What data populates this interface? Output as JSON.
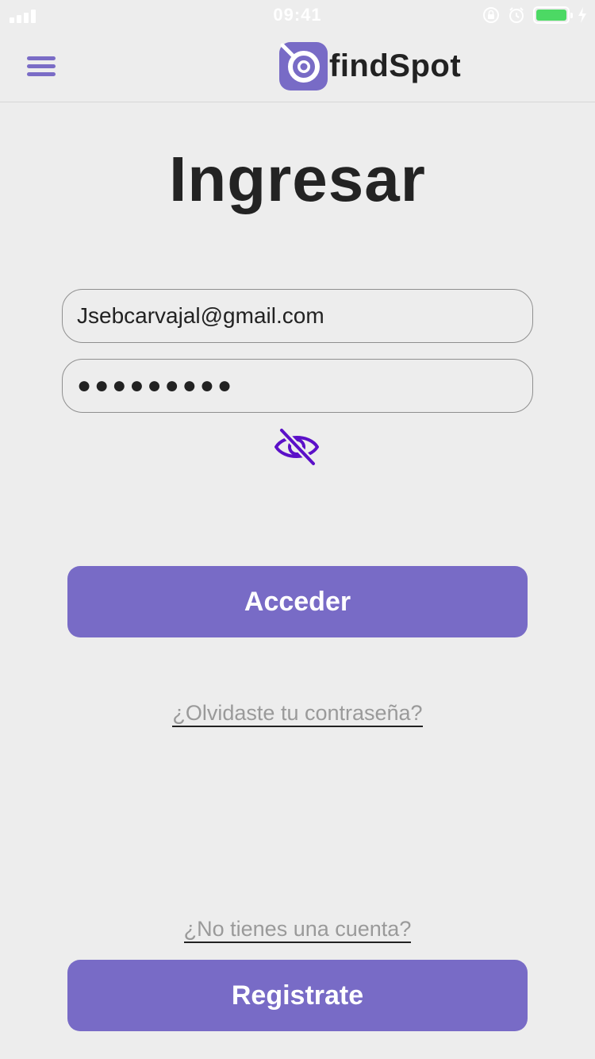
{
  "status_bar": {
    "time": "09:41"
  },
  "nav": {
    "menu_icon": "hamburger-menu-icon",
    "logo_text": "findSpot",
    "logo_icon": "findspot-logo-icon"
  },
  "login": {
    "title": "Ingresar",
    "email_value": "Jsebcarvajal@gmail.com",
    "password_value": "●●●●●●●●●",
    "eye_icon": "eye-slash-icon",
    "submit_label": "Acceder",
    "forgot_label": "¿Olvidaste tu contraseña?",
    "no_account_label": "¿No tienes una cuenta?",
    "register_label": "Registrate"
  },
  "colors": {
    "accent": "#786bc6",
    "eye_icon": "#5b10c8",
    "background": "#ededed",
    "title": "#232323",
    "battery": "#4cd964"
  }
}
